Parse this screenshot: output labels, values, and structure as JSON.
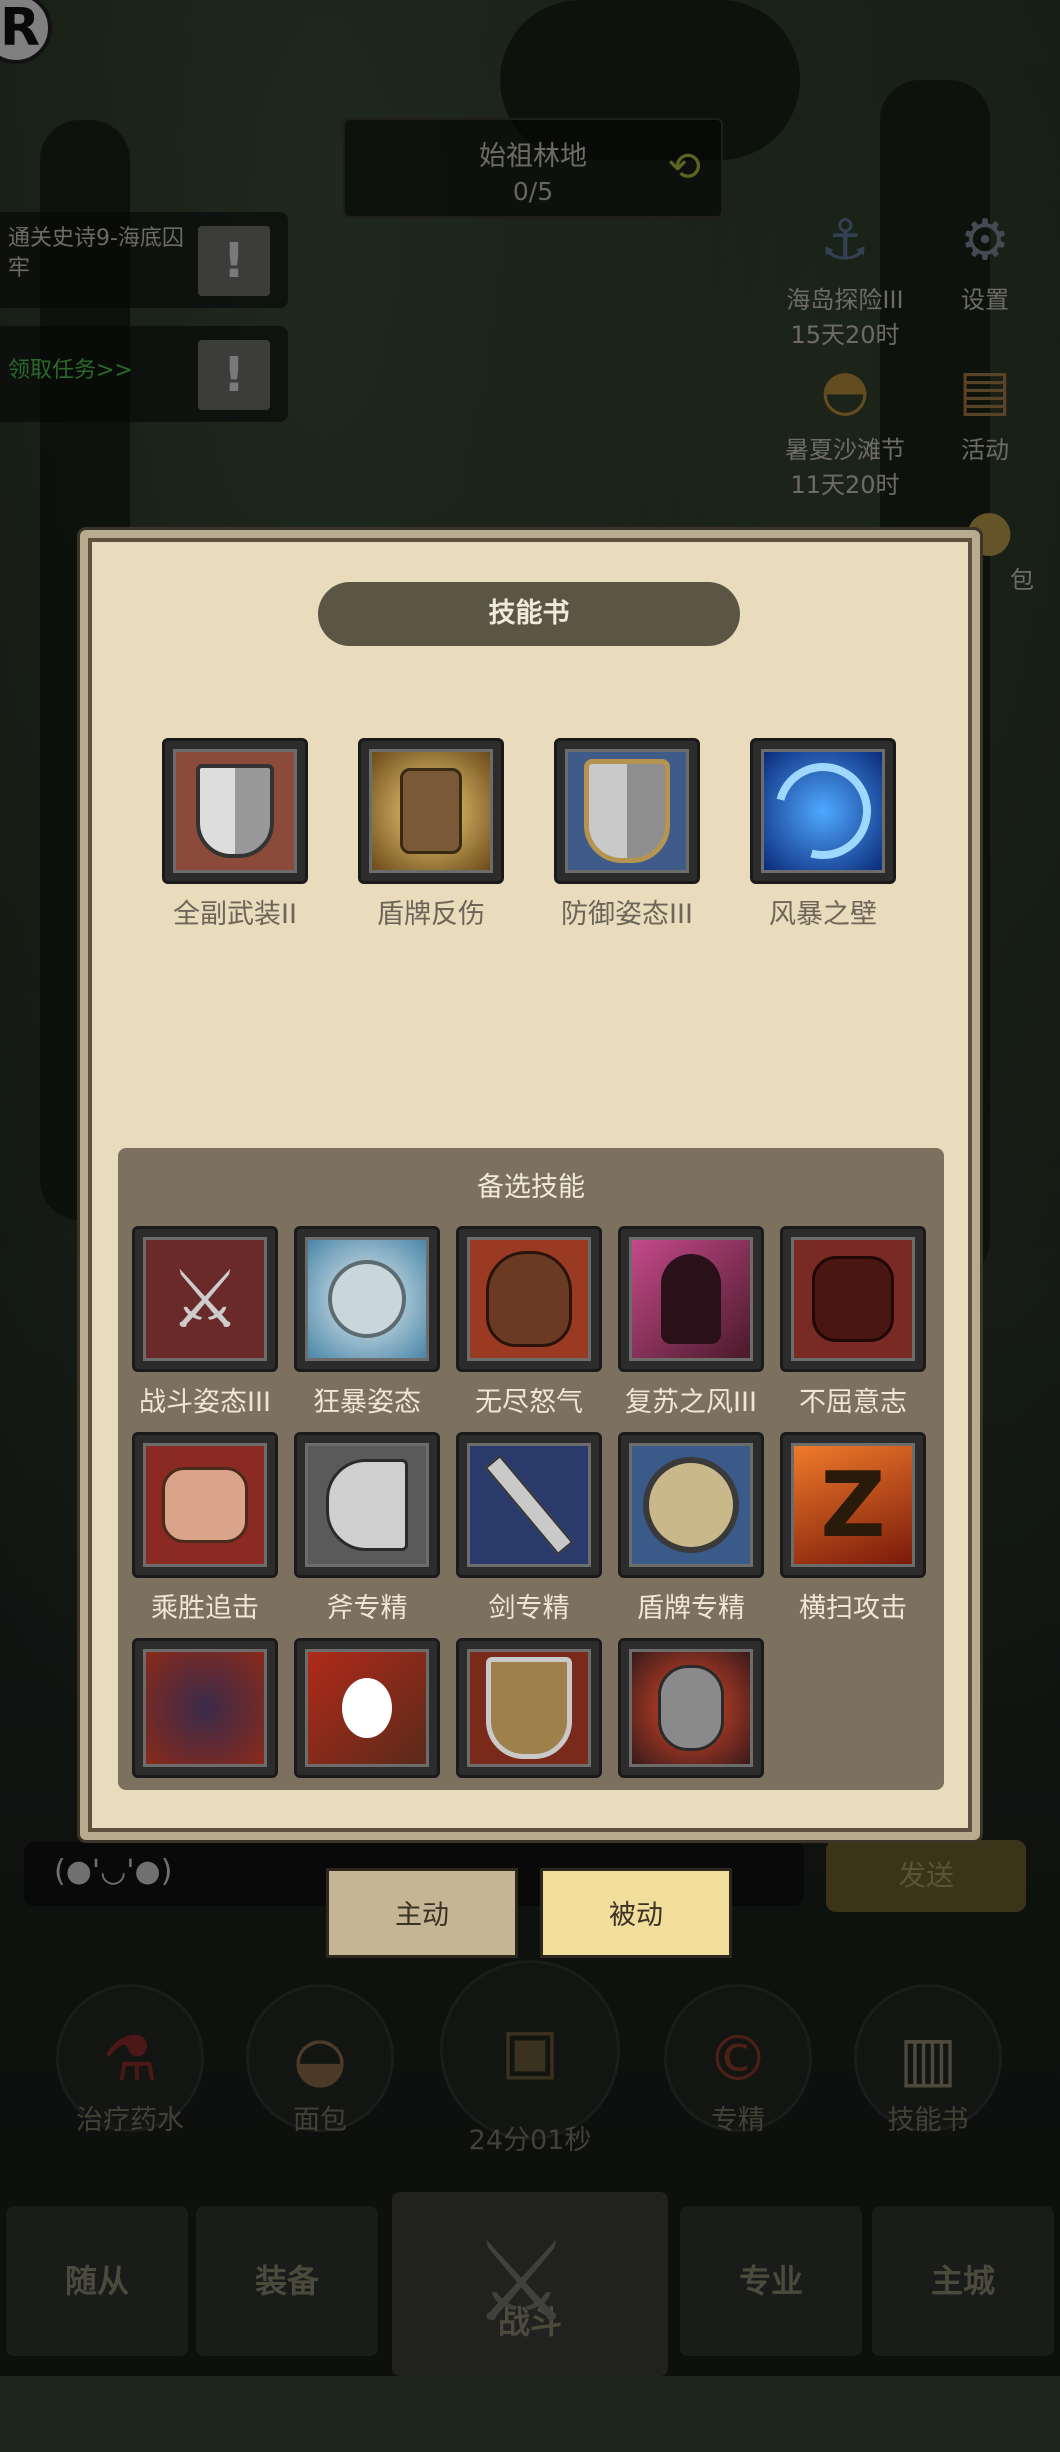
{
  "header": {
    "zone_name": "始祖林地",
    "zone_progress": "0/5",
    "refresh_icon": "refresh-icon",
    "logo_letter": "R"
  },
  "quests": [
    {
      "text": "通关史诗9-海底囚牢",
      "badge": "!"
    },
    {
      "text": "领取任务>>",
      "badge": "!"
    }
  ],
  "side_buttons": [
    {
      "label": "海岛探险III",
      "sub": "15天20时",
      "icon": "anchor-icon"
    },
    {
      "label": "设置",
      "sub": "",
      "icon": "gear-icon"
    },
    {
      "label": "暑夏沙滩节",
      "sub": "11天20时",
      "icon": "beach-hat-icon"
    },
    {
      "label": "活动",
      "sub": "",
      "icon": "scroll-icon"
    },
    {
      "label": "包",
      "sub": "",
      "icon": "coin-bag-icon"
    }
  ],
  "dialog": {
    "title": "技能书",
    "equipped_skills": [
      {
        "label": "全副武装II",
        "icon": "shield-split-icon"
      },
      {
        "label": "盾牌反伤",
        "icon": "shield-reflect-icon"
      },
      {
        "label": "防御姿态III",
        "icon": "gray-shield-icon"
      },
      {
        "label": "风暴之壁",
        "icon": "storm-swirl-icon"
      }
    ],
    "candidate_title": "备选技能",
    "candidate_skills": [
      {
        "label": "战斗姿态III",
        "icon": "crossed-swords-icon"
      },
      {
        "label": "狂暴姿态",
        "icon": "berserker-icon"
      },
      {
        "label": "无尽怒气",
        "icon": "rage-face-icon"
      },
      {
        "label": "复苏之风III",
        "icon": "demon-wind-icon"
      },
      {
        "label": "不屈意志",
        "icon": "fist-icon"
      },
      {
        "label": "乘胜追击",
        "icon": "punch-icon"
      },
      {
        "label": "斧专精",
        "icon": "axe-icon"
      },
      {
        "label": "剑专精",
        "icon": "sword-icon"
      },
      {
        "label": "盾牌专精",
        "icon": "round-shield-icon"
      },
      {
        "label": "横扫攻击",
        "icon": "sweep-icon"
      },
      {
        "label": "",
        "icon": "dark-fist-icon"
      },
      {
        "label": "",
        "icon": "claw-icon"
      },
      {
        "label": "",
        "icon": "broken-shield-icon"
      },
      {
        "label": "",
        "icon": "bleed-claw-icon"
      }
    ]
  },
  "chat": {
    "placeholder": "(●'◡'●)",
    "send_label": "发送"
  },
  "tabs": {
    "active_label": "主动",
    "passive_label": "被动"
  },
  "quick_items": [
    {
      "label": "治疗药水",
      "icon": "potion-icon"
    },
    {
      "label": "面包",
      "icon": "bread-icon"
    },
    {
      "label": "24分01秒",
      "icon": "treasure-chest-icon"
    },
    {
      "label": "专精",
      "icon": "specialization-icon"
    },
    {
      "label": "技能书",
      "icon": "skill-book-icon"
    }
  ],
  "bottom_nav": [
    {
      "label": "随从"
    },
    {
      "label": "装备"
    },
    {
      "label": "战斗"
    },
    {
      "label": "专业"
    },
    {
      "label": "主城"
    }
  ],
  "colors": {
    "dialog_bg": "#e9dcbd",
    "candidate_bg": "#7c705e",
    "active_tab": "#f1dd9c",
    "quest_link": "#4cc04c"
  }
}
